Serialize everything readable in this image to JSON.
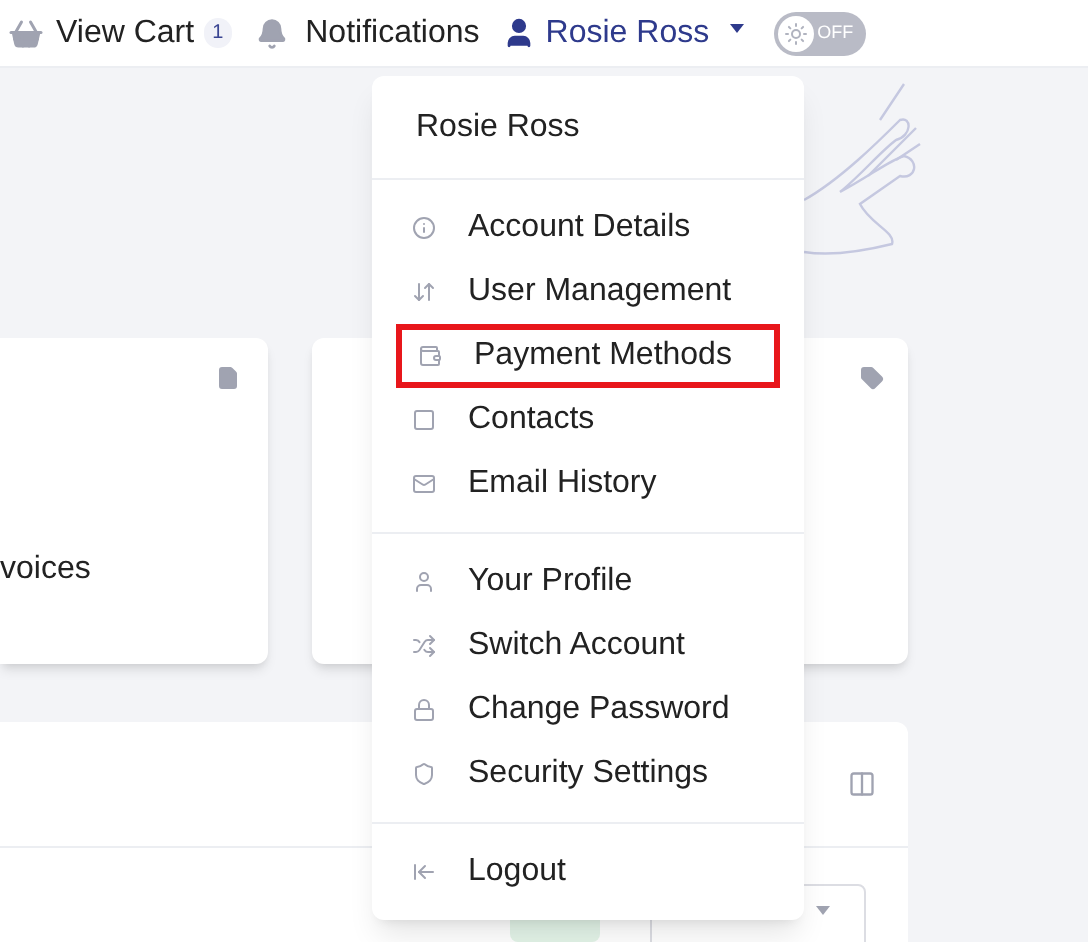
{
  "header": {
    "cart": {
      "label": "View Cart",
      "count": "1"
    },
    "notifications": {
      "label": "Notifications"
    },
    "user": {
      "name": "Rosie Ross"
    },
    "theme_toggle": {
      "label": "OFF",
      "on": false
    }
  },
  "cards": [
    {
      "text": "voices"
    }
  ],
  "user_menu": {
    "title": "Rosie Ross",
    "groups": [
      [
        {
          "label": "Account Details",
          "highlighted": false
        },
        {
          "label": "User Management",
          "highlighted": false
        },
        {
          "label": "Payment Methods",
          "highlighted": true
        },
        {
          "label": "Contacts",
          "highlighted": false
        },
        {
          "label": "Email History",
          "highlighted": false
        }
      ],
      [
        {
          "label": "Your Profile",
          "highlighted": false
        },
        {
          "label": "Switch Account",
          "highlighted": false
        },
        {
          "label": "Change Password",
          "highlighted": false
        },
        {
          "label": "Security Settings",
          "highlighted": false
        }
      ],
      [
        {
          "label": "Logout",
          "highlighted": false
        }
      ]
    ]
  }
}
